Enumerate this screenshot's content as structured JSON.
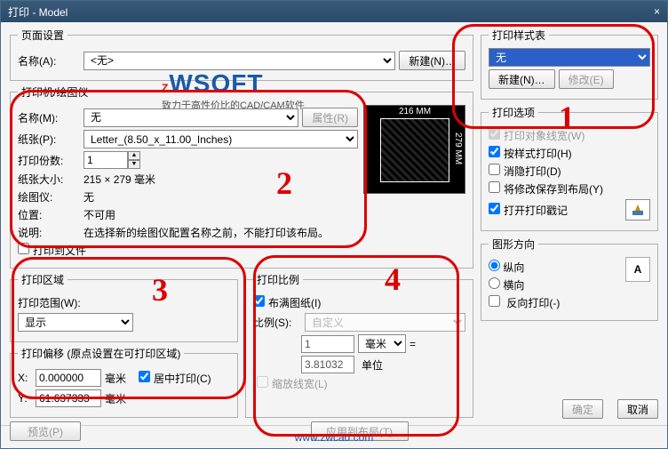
{
  "window": {
    "title": "打印 - Model",
    "close": "×"
  },
  "pageSetup": {
    "legend": "页面设置",
    "nameLabel": "名称(A):",
    "nameValue": "<无>",
    "newBtn": "新建(N)…"
  },
  "printer": {
    "legend": "打印机/绘图仪",
    "nameLabel": "名称(M):",
    "nameValue": "无",
    "propsBtn": "属性(R)",
    "paperLabel": "纸张(P):",
    "paperValue": "Letter_(8.50_x_11.00_Inches)",
    "copiesLabel": "打印份数:",
    "copiesValue": "1",
    "sizeLabel": "纸张大小:",
    "sizeValue": "215 × 279  毫米",
    "plotterLabel": "绘图仪:",
    "plotterValue": "无",
    "posLabel": "位置:",
    "posValue": "不可用",
    "descLabel": "说明:",
    "descValue": "在选择新的绘图仪配置名称之前，不能打印该布局。",
    "toFile": "打印到文件",
    "preview": {
      "width": "216 MM",
      "height": "279 MM"
    }
  },
  "area": {
    "legend": "打印区域",
    "rangeLabel": "打印范围(W):",
    "rangeValue": "显示"
  },
  "offset": {
    "legend": "打印偏移 (原点设置在可打印区域)",
    "xLabel": "X:",
    "xValue": "0.000000",
    "xUnit": "毫米",
    "yLabel": "Y:",
    "yValue": "61.637333",
    "yUnit": "毫米",
    "center": "居中打印(C)"
  },
  "previewBtn": "预览(P)",
  "scale": {
    "legend": "打印比例",
    "fit": "布满图纸(I)",
    "ratioLabel": "比例(S):",
    "ratioValue": "自定义",
    "num1": "1",
    "unit1": "毫米",
    "eq": "=",
    "num2": "3.81032",
    "unit2": "单位",
    "lineweight": "缩放线宽(L)"
  },
  "applyBtn": "应用到布局(T)",
  "styleTable": {
    "legend": "打印样式表",
    "value": "无",
    "newBtn": "新建(N)…",
    "editBtn": "修改(E)"
  },
  "options": {
    "legend": "打印选项",
    "o1": "打印对象线宽(W)",
    "o2": "按样式打印(H)",
    "o3": "消隐打印(D)",
    "o4": "将修改保存到布局(Y)",
    "o5": "打开打印戳记"
  },
  "orient": {
    "legend": "图形方向",
    "portrait": "纵向",
    "landscape": "横向",
    "reverse": "反向打印(-)",
    "glyph": "A"
  },
  "buttons": {
    "ok": "确定",
    "cancel": "取消"
  },
  "footer": {
    "url": "www.zwcad.com"
  },
  "logo": {
    "brand": "ZWSOFT",
    "sub": "致力于高性价比的CAD/CAM软件"
  },
  "annotations": {
    "n1": "1",
    "n2": "2",
    "n3": "3",
    "n4": "4"
  }
}
